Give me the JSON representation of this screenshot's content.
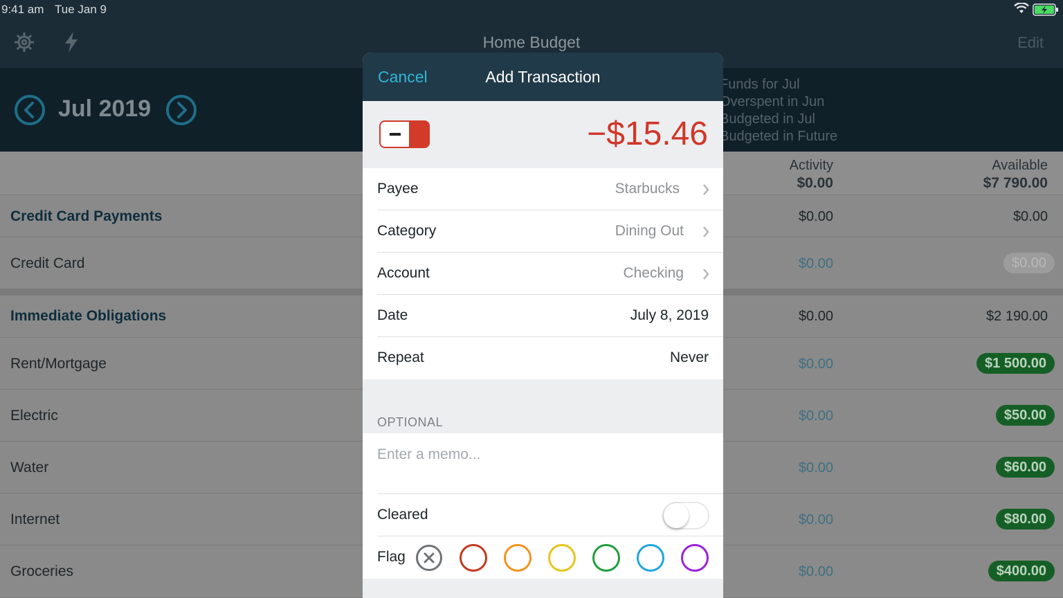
{
  "status_bar": {
    "time": "9:41 am",
    "date": "Tue Jan 9"
  },
  "nav": {
    "title": "Home Budget",
    "edit_label": "Edit"
  },
  "month": {
    "label": "Jul 2019"
  },
  "funds_summary": [
    "Funds for Jul",
    "Overspent in Jun",
    "Budgeted in Jul",
    "Budgeted in Future"
  ],
  "columns": {
    "activity": {
      "label": "Activity",
      "total": "$0.00"
    },
    "available": {
      "label": "Available",
      "total": "$7 790.00"
    }
  },
  "rows": [
    {
      "name": "Credit Card Payments",
      "activity": "$0.00",
      "available": "$0.00"
    },
    {
      "name": "Credit Card",
      "activity": "$0.00",
      "available": "$0.00"
    },
    {
      "name": "Immediate Obligations",
      "activity": "$0.00",
      "available": "$2 190.00"
    },
    {
      "name": "Rent/Mortgage",
      "activity": "$0.00",
      "available": "$1 500.00"
    },
    {
      "name": "Electric",
      "activity": "$0.00",
      "available": "$50.00"
    },
    {
      "name": "Water",
      "activity": "$0.00",
      "available": "$60.00"
    },
    {
      "name": "Internet",
      "activity": "$0.00",
      "available": "$80.00"
    },
    {
      "name": "Groceries",
      "activity": "$0.00",
      "available": "$400.00"
    }
  ],
  "modal": {
    "cancel_label": "Cancel",
    "title": "Add Transaction",
    "amount": "−$15.46",
    "fields": {
      "payee": {
        "label": "Payee",
        "value": "Starbucks"
      },
      "category": {
        "label": "Category",
        "value": "Dining Out"
      },
      "account": {
        "label": "Account",
        "value": "Checking"
      },
      "date": {
        "label": "Date",
        "value": "July 8, 2019"
      },
      "repeat": {
        "label": "Repeat",
        "value": "Never"
      }
    },
    "optional_label": "OPTIONAL",
    "memo_placeholder": "Enter a memo...",
    "cleared_label": "Cleared",
    "cleared_on": false,
    "flag_label": "Flag",
    "flag_colors": {
      "red": "#c0391f",
      "orange": "#f0931d",
      "yellow": "#e8c41a",
      "green": "#1e9e3a",
      "blue": "#1fa6dd",
      "purple": "#9b21d8"
    }
  },
  "colors": {
    "accent": "#2fb6d9",
    "negative": "#cf3729",
    "available_pill": "#155f26"
  }
}
